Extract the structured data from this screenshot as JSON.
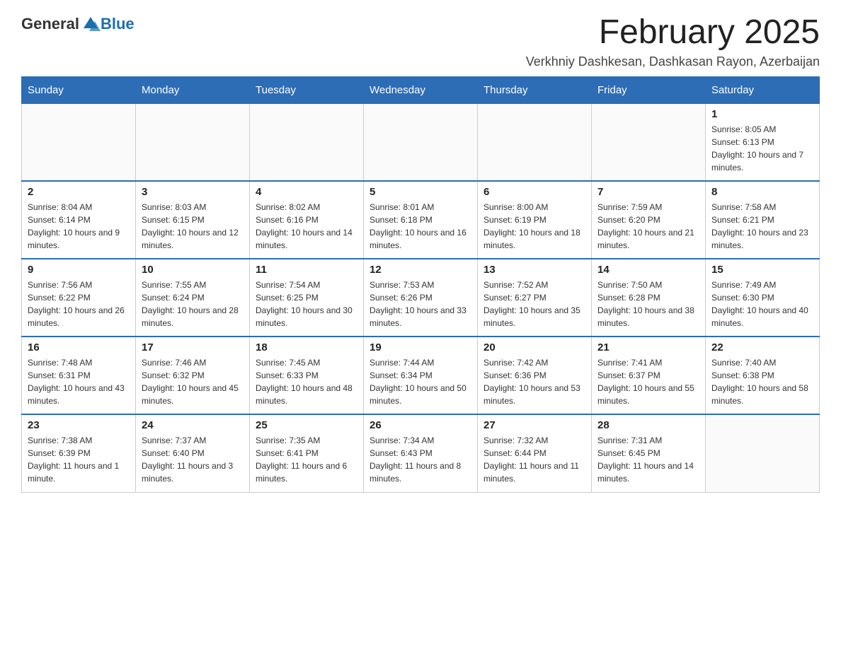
{
  "header": {
    "logo_general": "General",
    "logo_blue": "Blue",
    "month_title": "February 2025",
    "location": "Verkhniy Dashkesan, Dashkasan Rayon, Azerbaijan"
  },
  "days_of_week": [
    "Sunday",
    "Monday",
    "Tuesday",
    "Wednesday",
    "Thursday",
    "Friday",
    "Saturday"
  ],
  "weeks": [
    [
      {
        "day": "",
        "sunrise": "",
        "sunset": "",
        "daylight": ""
      },
      {
        "day": "",
        "sunrise": "",
        "sunset": "",
        "daylight": ""
      },
      {
        "day": "",
        "sunrise": "",
        "sunset": "",
        "daylight": ""
      },
      {
        "day": "",
        "sunrise": "",
        "sunset": "",
        "daylight": ""
      },
      {
        "day": "",
        "sunrise": "",
        "sunset": "",
        "daylight": ""
      },
      {
        "day": "",
        "sunrise": "",
        "sunset": "",
        "daylight": ""
      },
      {
        "day": "1",
        "sunrise": "Sunrise: 8:05 AM",
        "sunset": "Sunset: 6:13 PM",
        "daylight": "Daylight: 10 hours and 7 minutes."
      }
    ],
    [
      {
        "day": "2",
        "sunrise": "Sunrise: 8:04 AM",
        "sunset": "Sunset: 6:14 PM",
        "daylight": "Daylight: 10 hours and 9 minutes."
      },
      {
        "day": "3",
        "sunrise": "Sunrise: 8:03 AM",
        "sunset": "Sunset: 6:15 PM",
        "daylight": "Daylight: 10 hours and 12 minutes."
      },
      {
        "day": "4",
        "sunrise": "Sunrise: 8:02 AM",
        "sunset": "Sunset: 6:16 PM",
        "daylight": "Daylight: 10 hours and 14 minutes."
      },
      {
        "day": "5",
        "sunrise": "Sunrise: 8:01 AM",
        "sunset": "Sunset: 6:18 PM",
        "daylight": "Daylight: 10 hours and 16 minutes."
      },
      {
        "day": "6",
        "sunrise": "Sunrise: 8:00 AM",
        "sunset": "Sunset: 6:19 PM",
        "daylight": "Daylight: 10 hours and 18 minutes."
      },
      {
        "day": "7",
        "sunrise": "Sunrise: 7:59 AM",
        "sunset": "Sunset: 6:20 PM",
        "daylight": "Daylight: 10 hours and 21 minutes."
      },
      {
        "day": "8",
        "sunrise": "Sunrise: 7:58 AM",
        "sunset": "Sunset: 6:21 PM",
        "daylight": "Daylight: 10 hours and 23 minutes."
      }
    ],
    [
      {
        "day": "9",
        "sunrise": "Sunrise: 7:56 AM",
        "sunset": "Sunset: 6:22 PM",
        "daylight": "Daylight: 10 hours and 26 minutes."
      },
      {
        "day": "10",
        "sunrise": "Sunrise: 7:55 AM",
        "sunset": "Sunset: 6:24 PM",
        "daylight": "Daylight: 10 hours and 28 minutes."
      },
      {
        "day": "11",
        "sunrise": "Sunrise: 7:54 AM",
        "sunset": "Sunset: 6:25 PM",
        "daylight": "Daylight: 10 hours and 30 minutes."
      },
      {
        "day": "12",
        "sunrise": "Sunrise: 7:53 AM",
        "sunset": "Sunset: 6:26 PM",
        "daylight": "Daylight: 10 hours and 33 minutes."
      },
      {
        "day": "13",
        "sunrise": "Sunrise: 7:52 AM",
        "sunset": "Sunset: 6:27 PM",
        "daylight": "Daylight: 10 hours and 35 minutes."
      },
      {
        "day": "14",
        "sunrise": "Sunrise: 7:50 AM",
        "sunset": "Sunset: 6:28 PM",
        "daylight": "Daylight: 10 hours and 38 minutes."
      },
      {
        "day": "15",
        "sunrise": "Sunrise: 7:49 AM",
        "sunset": "Sunset: 6:30 PM",
        "daylight": "Daylight: 10 hours and 40 minutes."
      }
    ],
    [
      {
        "day": "16",
        "sunrise": "Sunrise: 7:48 AM",
        "sunset": "Sunset: 6:31 PM",
        "daylight": "Daylight: 10 hours and 43 minutes."
      },
      {
        "day": "17",
        "sunrise": "Sunrise: 7:46 AM",
        "sunset": "Sunset: 6:32 PM",
        "daylight": "Daylight: 10 hours and 45 minutes."
      },
      {
        "day": "18",
        "sunrise": "Sunrise: 7:45 AM",
        "sunset": "Sunset: 6:33 PM",
        "daylight": "Daylight: 10 hours and 48 minutes."
      },
      {
        "day": "19",
        "sunrise": "Sunrise: 7:44 AM",
        "sunset": "Sunset: 6:34 PM",
        "daylight": "Daylight: 10 hours and 50 minutes."
      },
      {
        "day": "20",
        "sunrise": "Sunrise: 7:42 AM",
        "sunset": "Sunset: 6:36 PM",
        "daylight": "Daylight: 10 hours and 53 minutes."
      },
      {
        "day": "21",
        "sunrise": "Sunrise: 7:41 AM",
        "sunset": "Sunset: 6:37 PM",
        "daylight": "Daylight: 10 hours and 55 minutes."
      },
      {
        "day": "22",
        "sunrise": "Sunrise: 7:40 AM",
        "sunset": "Sunset: 6:38 PM",
        "daylight": "Daylight: 10 hours and 58 minutes."
      }
    ],
    [
      {
        "day": "23",
        "sunrise": "Sunrise: 7:38 AM",
        "sunset": "Sunset: 6:39 PM",
        "daylight": "Daylight: 11 hours and 1 minute."
      },
      {
        "day": "24",
        "sunrise": "Sunrise: 7:37 AM",
        "sunset": "Sunset: 6:40 PM",
        "daylight": "Daylight: 11 hours and 3 minutes."
      },
      {
        "day": "25",
        "sunrise": "Sunrise: 7:35 AM",
        "sunset": "Sunset: 6:41 PM",
        "daylight": "Daylight: 11 hours and 6 minutes."
      },
      {
        "day": "26",
        "sunrise": "Sunrise: 7:34 AM",
        "sunset": "Sunset: 6:43 PM",
        "daylight": "Daylight: 11 hours and 8 minutes."
      },
      {
        "day": "27",
        "sunrise": "Sunrise: 7:32 AM",
        "sunset": "Sunset: 6:44 PM",
        "daylight": "Daylight: 11 hours and 11 minutes."
      },
      {
        "day": "28",
        "sunrise": "Sunrise: 7:31 AM",
        "sunset": "Sunset: 6:45 PM",
        "daylight": "Daylight: 11 hours and 14 minutes."
      },
      {
        "day": "",
        "sunrise": "",
        "sunset": "",
        "daylight": ""
      }
    ]
  ]
}
